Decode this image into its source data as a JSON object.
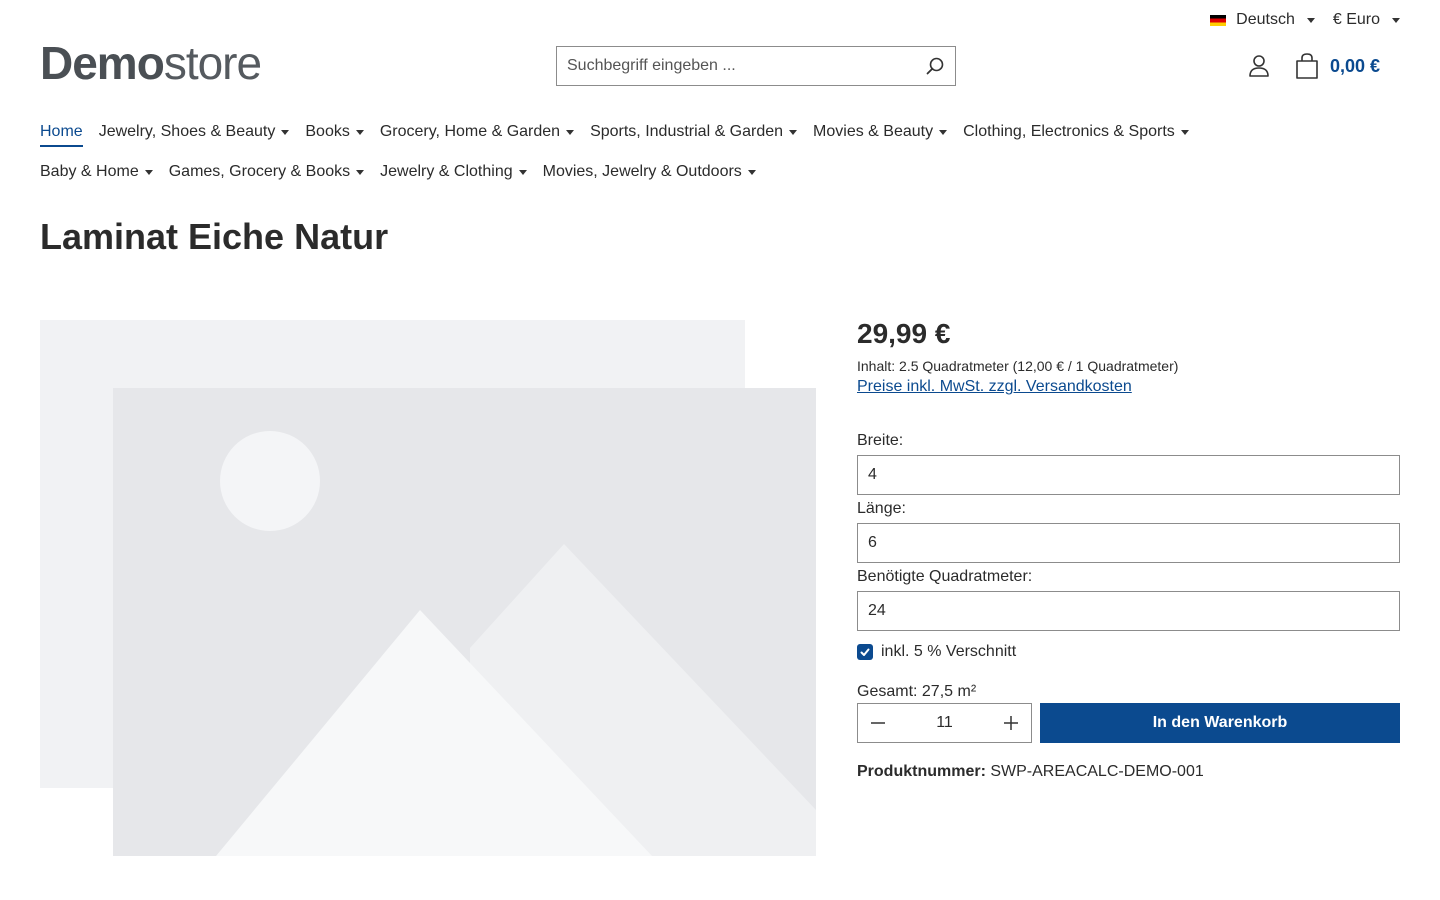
{
  "topbar": {
    "language": "Deutsch",
    "currency": "€ Euro"
  },
  "header": {
    "logo_bold": "Demo",
    "logo_light": "store",
    "search_placeholder": "Suchbegriff eingeben ...",
    "cart_total": "0,00 €"
  },
  "nav": {
    "row1": [
      {
        "label": "Home",
        "active": true,
        "dropdown": false
      },
      {
        "label": "Jewelry, Shoes & Beauty",
        "dropdown": true
      },
      {
        "label": "Books",
        "dropdown": true
      },
      {
        "label": "Grocery, Home & Garden",
        "dropdown": true
      },
      {
        "label": "Sports, Industrial & Garden",
        "dropdown": true
      },
      {
        "label": "Movies & Beauty",
        "dropdown": true
      },
      {
        "label": "Clothing, Electronics & Sports",
        "dropdown": true
      }
    ],
    "row2": [
      {
        "label": "Baby & Home",
        "dropdown": true
      },
      {
        "label": "Games, Grocery & Books",
        "dropdown": true
      },
      {
        "label": "Jewelry & Clothing",
        "dropdown": true
      },
      {
        "label": "Movies, Jewelry & Outdoors",
        "dropdown": true
      }
    ]
  },
  "product": {
    "title": "Laminat Eiche Natur",
    "price": "29,99 €",
    "content": "Inhalt: 2.5 Quadratmeter (12,00 € / 1 Quadratmeter)",
    "tax_link": "Preise inkl. MwSt. zzgl. Versandkosten",
    "fields": {
      "width_label": "Breite:",
      "width_value": "4",
      "length_label": "Länge:",
      "length_value": "6",
      "sqm_label": "Benötigte Quadratmeter:",
      "sqm_value": "24"
    },
    "waste_checkbox": {
      "label": "inkl. 5 % Verschnitt",
      "checked": true
    },
    "total": "Gesamt: 27,5 m²",
    "quantity": "11",
    "add_to_cart": "In den Warenkorb",
    "sku_label": "Produktnummer:",
    "sku_value": "SWP-AREACALC-DEMO-001"
  },
  "colors": {
    "accent": "#0b4a8f",
    "placeholder_light": "#f1f2f4",
    "placeholder_mid": "#e6e7ea"
  }
}
